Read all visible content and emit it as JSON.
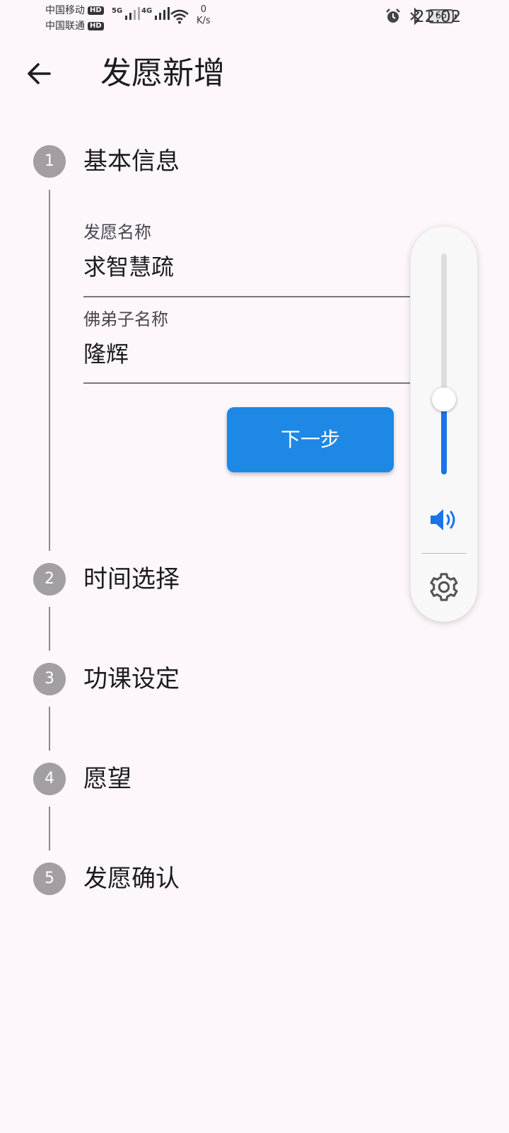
{
  "status_bar": {
    "carrier1": "中国移动",
    "carrier2": "中国联通",
    "hd_badge": "HD",
    "sig1_label": "5G",
    "sig2_label": "4G",
    "speed_value": "0",
    "speed_unit": "K/s",
    "battery": "65",
    "time": "22:02",
    "icons": [
      "alarm-icon",
      "bluetooth-icon",
      "wifi-icon"
    ]
  },
  "app_bar": {
    "title": "发愿新增",
    "back_icon": "arrow-left-icon"
  },
  "stepper": {
    "steps": [
      {
        "number": "1",
        "title": "基本信息",
        "active": true
      },
      {
        "number": "2",
        "title": "时间选择",
        "active": false
      },
      {
        "number": "3",
        "title": "功课设定",
        "active": false
      },
      {
        "number": "4",
        "title": "愿望",
        "active": false
      },
      {
        "number": "5",
        "title": "发愿确认",
        "active": false
      }
    ],
    "fields": [
      {
        "label": "发愿名称",
        "value": "求智慧疏"
      },
      {
        "label": "佛弟子名称",
        "value": "隆辉"
      }
    ],
    "next_label": "下一步"
  },
  "volume_panel": {
    "level": 0.34,
    "speaker_icon": "speaker-icon",
    "settings_icon": "gear-icon"
  },
  "colors": {
    "background": "#fdf7fc",
    "accent": "#1e88e5",
    "step_circle": "#a39ea4",
    "volume_fill": "#1a73e8"
  }
}
